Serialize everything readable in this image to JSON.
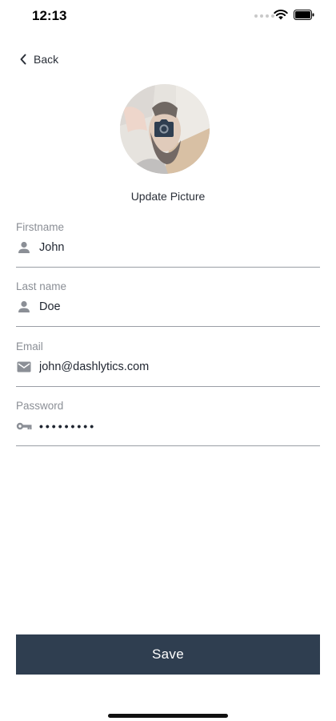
{
  "status_bar": {
    "time": "12:13"
  },
  "back": {
    "label": "Back"
  },
  "profile": {
    "update_picture_label": "Update Picture"
  },
  "fields": [
    {
      "label": "Firstname",
      "value": "John",
      "icon": "person-icon"
    },
    {
      "label": "Last name",
      "value": "Doe",
      "icon": "person-icon"
    },
    {
      "label": "Email",
      "value": "john@dashlytics.com",
      "icon": "mail-icon"
    },
    {
      "label": "Password",
      "value": "•••••••••",
      "icon": "key-icon"
    }
  ],
  "save": {
    "label": "Save"
  },
  "colors": {
    "accent": "#2f3e50",
    "label": "#8b8f96",
    "divider": "#9a9ea5"
  }
}
